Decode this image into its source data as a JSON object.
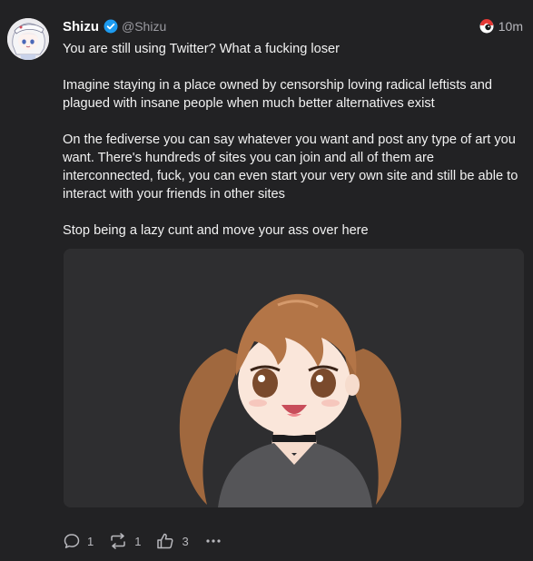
{
  "author": {
    "display_name": "Shizu",
    "handle": "@Shizu",
    "avatar_icon": "avatar-anime-girl",
    "verified_icon": "verified-badge-icon"
  },
  "post": {
    "time": "10m",
    "instance_icon": "instance-favicon",
    "paragraphs": [
      "You are still using Twitter? What a fucking loser",
      "Imagine staying in a place owned by censorship loving radical leftists and plagued with insane people when much better alternatives exist",
      "On the fediverse you can say whatever you want and post any type of art you want. There's hundreds of sites you can join and all of them are interconnected, fuck, you can even start your very own site and still be able to interact with your friends in other sites",
      "Stop being a lazy cunt and move your ass over here"
    ],
    "media_icon": "anime-girl-illustration"
  },
  "actions": {
    "reply_count": "1",
    "repost_count": "1",
    "like_count": "3",
    "icons": [
      "reply-icon",
      "repost-icon",
      "like-icon",
      "more-icon"
    ]
  },
  "colors": {
    "background": "#222224",
    "media_background": "#2e2e30",
    "verified_blue": "#1d9bf0",
    "muted_text": "#9a9aa0"
  }
}
